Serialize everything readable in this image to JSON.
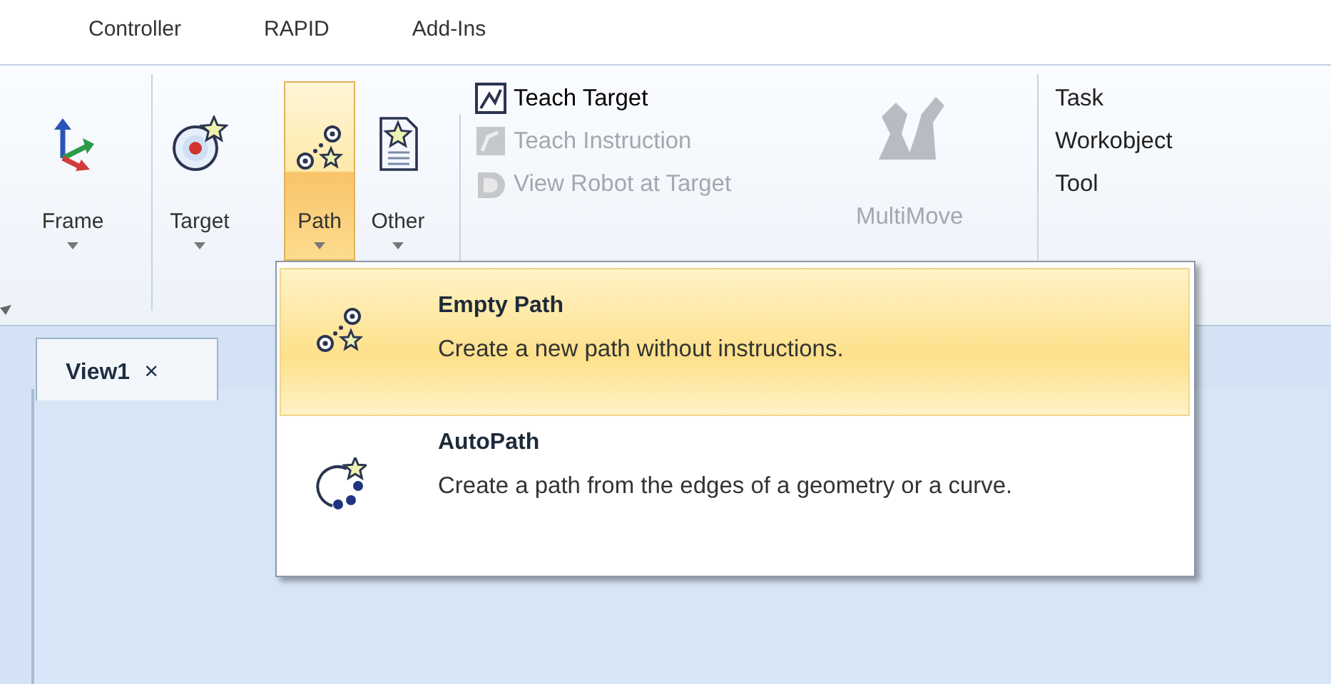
{
  "menu_tabs": [
    {
      "label": "Controller"
    },
    {
      "label": "RAPID"
    },
    {
      "label": "Add-Ins"
    }
  ],
  "ribbon": {
    "large_buttons": [
      {
        "label": "Frame",
        "selected": false
      },
      {
        "label": "Target",
        "selected": false
      },
      {
        "label": "Path",
        "selected": true
      },
      {
        "label": "Other",
        "selected": false
      }
    ],
    "small_buttons": [
      {
        "label": "Teach Target",
        "disabled": false
      },
      {
        "label": "Teach Instruction",
        "disabled": true
      },
      {
        "label": "View Robot at Target",
        "disabled": true
      }
    ],
    "multimove": {
      "label": "MultiMove",
      "disabled": true
    },
    "settings": [
      {
        "label": "Task"
      },
      {
        "label": "Workobject"
      },
      {
        "label": "Tool"
      }
    ]
  },
  "document_tabs": [
    {
      "label": "View1",
      "close": "×",
      "selected": true
    }
  ],
  "path_menu": [
    {
      "title": "Empty Path",
      "description": "Create a new path without instructions.",
      "selected": true
    },
    {
      "title": "AutoPath",
      "description": "Create a path from the edges of a geometry or a curve.",
      "selected": false
    }
  ]
}
